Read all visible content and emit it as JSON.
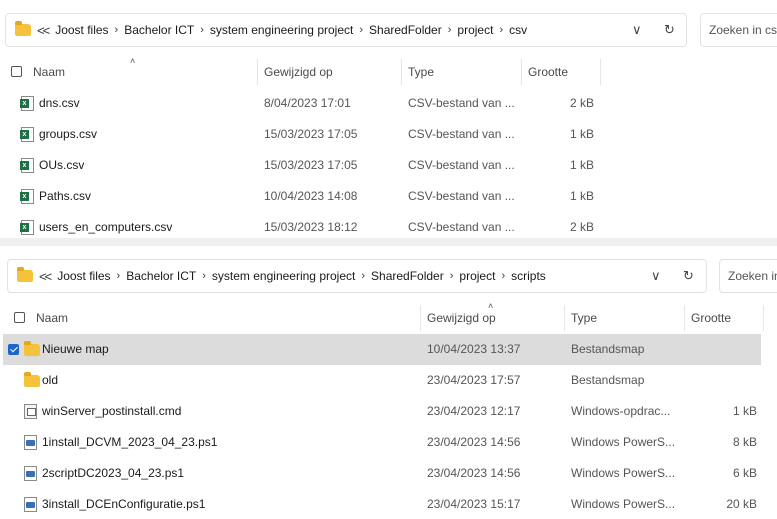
{
  "pane1": {
    "breadcrumb": [
      "Joost files",
      "Bachelor ICT",
      "system engineering project",
      "SharedFolder",
      "project",
      "csv"
    ],
    "search_placeholder": "Zoeken in csv",
    "columns": {
      "name": "Naam",
      "modified": "Gewijzigd op",
      "type": "Type",
      "size": "Grootte"
    },
    "files": [
      {
        "name": "dns.csv",
        "modified": "8/04/2023 17:01",
        "type": "CSV-bestand van ...",
        "size": "2 kB",
        "icon": "excel-csv-icon"
      },
      {
        "name": "groups.csv",
        "modified": "15/03/2023 17:05",
        "type": "CSV-bestand van ...",
        "size": "1 kB",
        "icon": "excel-csv-icon"
      },
      {
        "name": "OUs.csv",
        "modified": "15/03/2023 17:05",
        "type": "CSV-bestand van ...",
        "size": "1 kB",
        "icon": "excel-csv-icon"
      },
      {
        "name": "Paths.csv",
        "modified": "10/04/2023 14:08",
        "type": "CSV-bestand van ...",
        "size": "1 kB",
        "icon": "excel-csv-icon"
      },
      {
        "name": "users_en_computers.csv",
        "modified": "15/03/2023 18:12",
        "type": "CSV-bestand van ...",
        "size": "2 kB",
        "icon": "excel-csv-icon"
      }
    ]
  },
  "pane2": {
    "breadcrumb": [
      "Joost files",
      "Bachelor ICT",
      "system engineering project",
      "SharedFolder",
      "project",
      "scripts"
    ],
    "search_placeholder": "Zoeken in scripts",
    "columns": {
      "name": "Naam",
      "modified": "Gewijzigd op",
      "type": "Type",
      "size": "Grootte"
    },
    "files": [
      {
        "name": "Nieuwe map",
        "modified": "10/04/2023 13:37",
        "type": "Bestandsmap",
        "size": "",
        "icon": "folder-icon",
        "selected": true
      },
      {
        "name": "old",
        "modified": "23/04/2023 17:57",
        "type": "Bestandsmap",
        "size": "",
        "icon": "folder-icon"
      },
      {
        "name": "winServer_postinstall.cmd",
        "modified": "23/04/2023 12:17",
        "type": "Windows-opdrac...",
        "size": "1 kB",
        "icon": "cmd-script-icon"
      },
      {
        "name": "1install_DCVM_2023_04_23.ps1",
        "modified": "23/04/2023 14:56",
        "type": "Windows PowerS...",
        "size": "8 kB",
        "icon": "powershell-script-icon"
      },
      {
        "name": "2scriptDC2023_04_23.ps1",
        "modified": "23/04/2023 14:56",
        "type": "Windows PowerS...",
        "size": "6 kB",
        "icon": "powershell-script-icon"
      },
      {
        "name": "3install_DCEnConfiguratie.ps1",
        "modified": "23/04/2023 15:17",
        "type": "Windows PowerS...",
        "size": "20 kB",
        "icon": "powershell-script-icon"
      }
    ]
  }
}
